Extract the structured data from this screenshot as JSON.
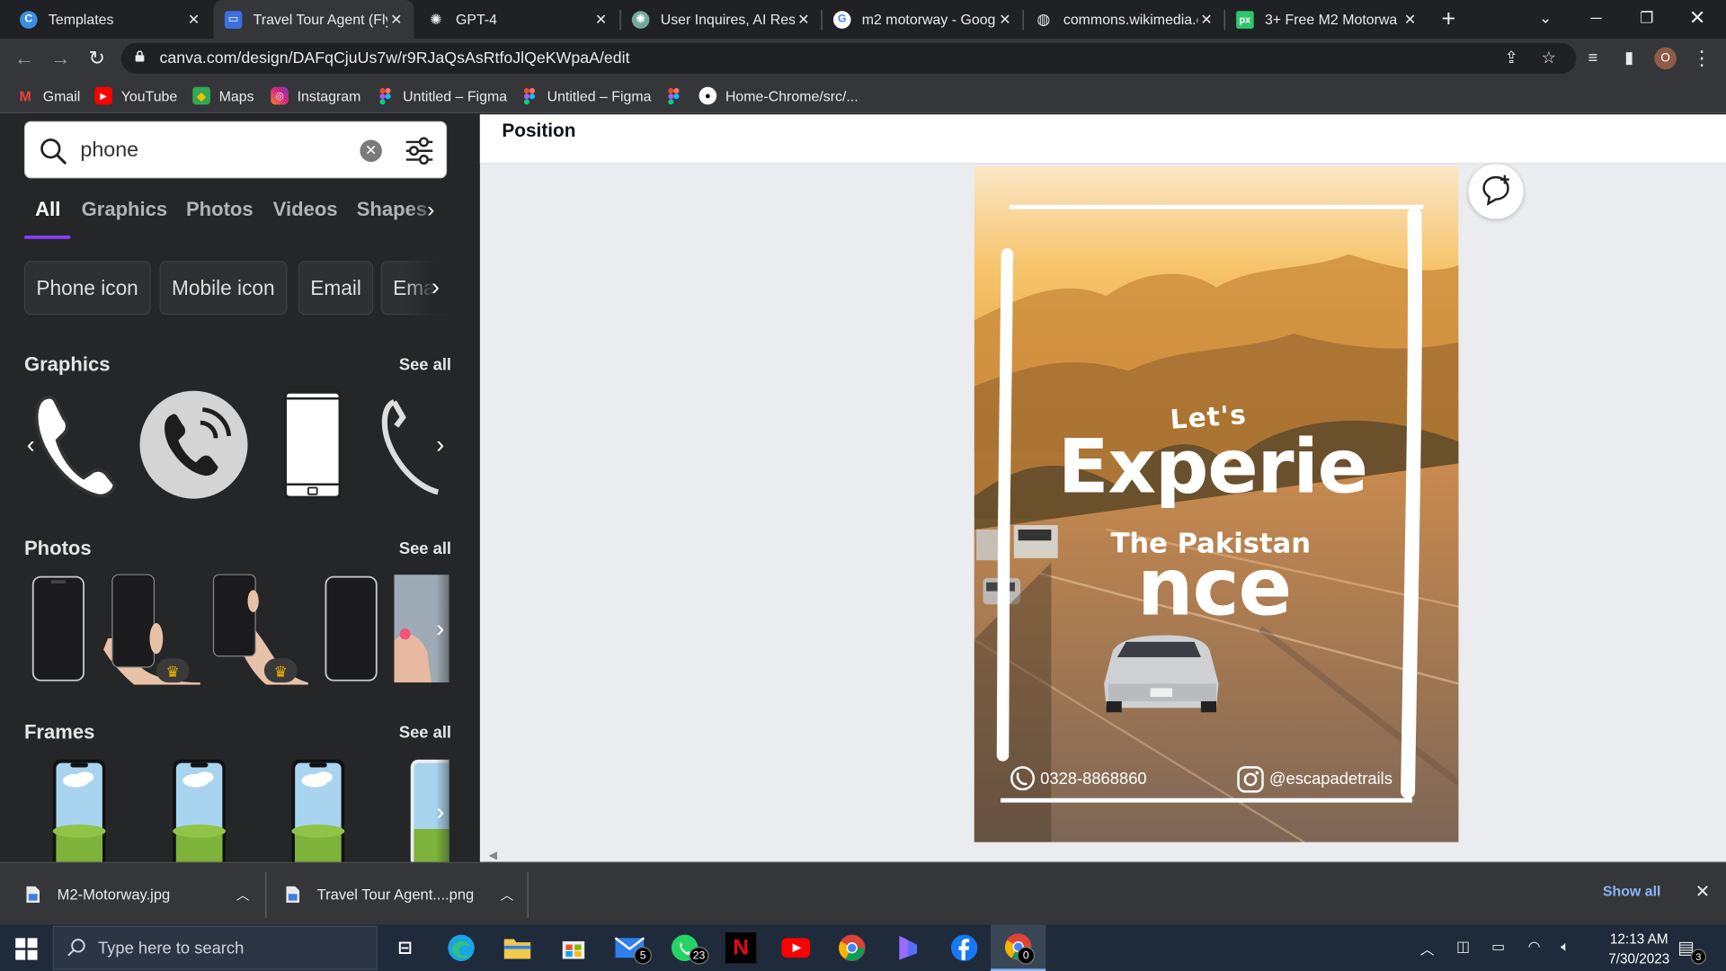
{
  "browser": {
    "tabs": [
      {
        "title": "Templates",
        "favicon": "canva-icon"
      },
      {
        "title": "Travel Tour Agent (Fly",
        "favicon": "canva-icon",
        "active": true
      },
      {
        "title": "GPT-4",
        "favicon": "openai-icon"
      },
      {
        "title": "User Inquires, AI Resp",
        "favicon": "openai-icon"
      },
      {
        "title": "m2 motorway - Goog",
        "favicon": "google-icon"
      },
      {
        "title": "commons.wikimedia.c",
        "favicon": "globe-icon"
      },
      {
        "title": "3+ Free M2 Motorwa",
        "favicon": "pixabay-icon"
      }
    ],
    "url": "canva.com/design/DAFqCjuUs7w/r9RJaQsAsRtfoJlQeKWpaA/edit",
    "profile_initial": "O",
    "bookmarks": [
      {
        "label": "Gmail",
        "icon": "gmail-icon"
      },
      {
        "label": "YouTube",
        "icon": "youtube-icon"
      },
      {
        "label": "Maps",
        "icon": "maps-icon"
      },
      {
        "label": "Instagram",
        "icon": "instagram-icon"
      },
      {
        "label": "Untitled – Figma",
        "icon": "figma-icon"
      },
      {
        "label": "Untitled – Figma",
        "icon": "figma-icon"
      },
      {
        "label": "",
        "icon": "figma-icon"
      },
      {
        "label": "Home-Chrome/src/...",
        "icon": "github-icon"
      }
    ]
  },
  "panel": {
    "search_value": "phone",
    "tabs": [
      "All",
      "Graphics",
      "Photos",
      "Videos",
      "Shapes"
    ],
    "chips": [
      "Phone icon",
      "Mobile icon",
      "Email",
      "Email"
    ],
    "sections": {
      "graphics": {
        "title": "Graphics",
        "see_all": "See all"
      },
      "photos": {
        "title": "Photos",
        "see_all": "See all"
      },
      "frames": {
        "title": "Frames",
        "see_all": "See all"
      }
    }
  },
  "canvas": {
    "position_label": "Position",
    "poster": {
      "lets": "Let's",
      "experie": "Experie",
      "pakistan": "The Pakistan",
      "nce": "nce",
      "phone": "0328-8868860",
      "instagram": "@escapadetrails"
    }
  },
  "downloads": [
    {
      "name": "M2-Motorway.jpg"
    },
    {
      "name": "Travel Tour Agent....png"
    }
  ],
  "downloads_show_all": "Show all",
  "taskbar": {
    "search_placeholder": "Type here to search",
    "mail_badge": "5",
    "whatsapp_badge": "23",
    "chrome_badge": "0",
    "notification_badge": "3",
    "time": "12:13 AM",
    "date": "7/30/2023"
  },
  "colors": {
    "canva_purple": "#8b3dff",
    "panel_bg": "#252627",
    "workspace_bg": "#ebecf0",
    "chrome_dark": "#202124",
    "chrome_toolbar": "#35363a",
    "link_blue": "#8ab4f8"
  }
}
